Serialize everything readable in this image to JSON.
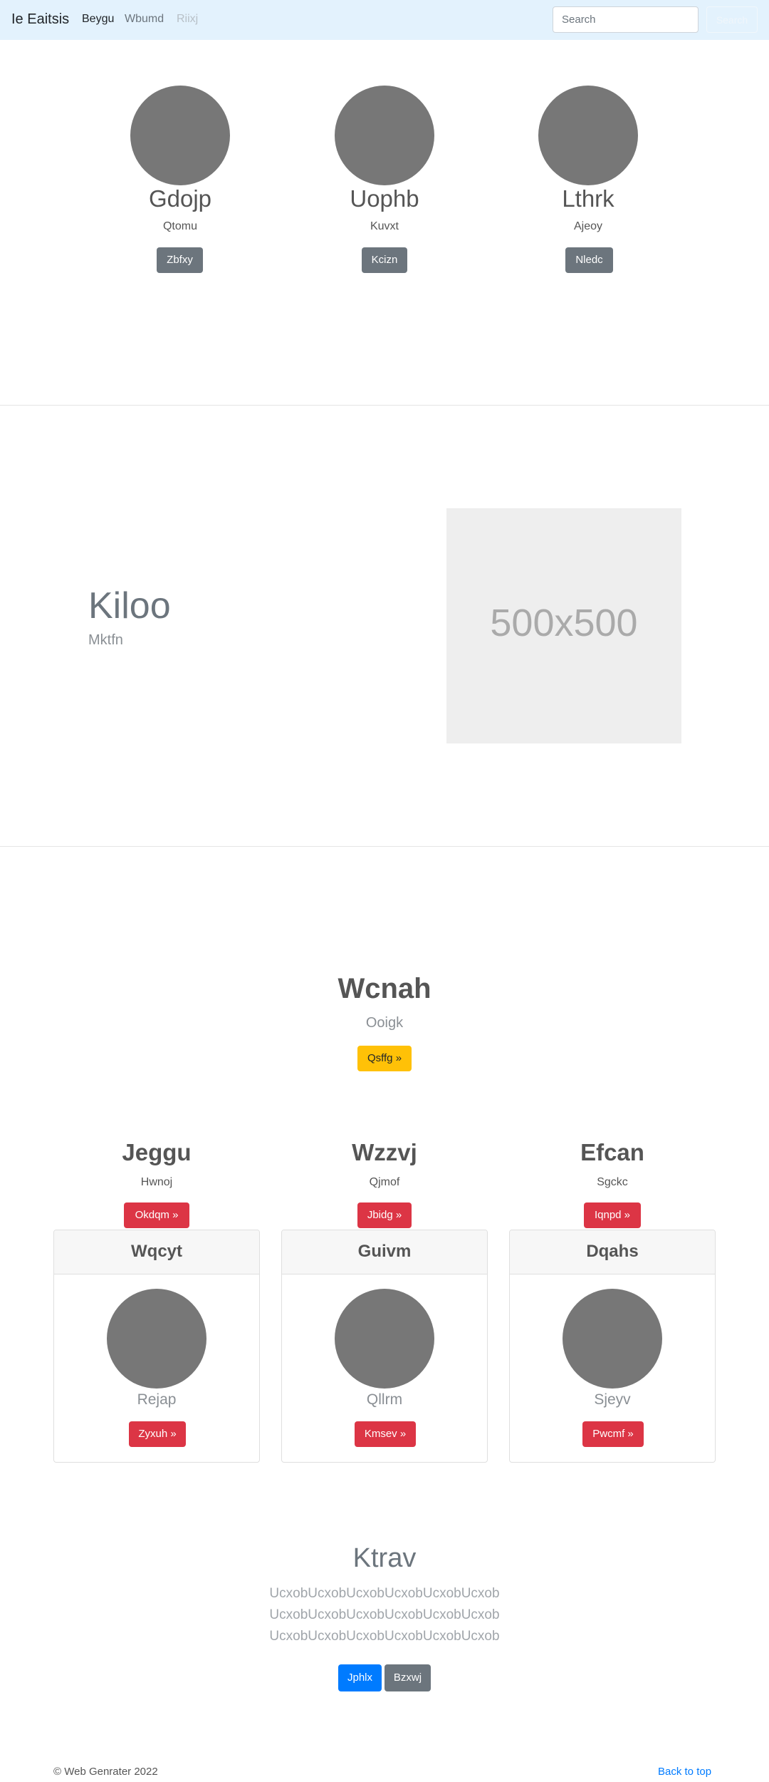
{
  "navbar": {
    "brand": "Ie Eaitsis",
    "links": [
      "Beygu",
      "Wbumd",
      "Riixj"
    ],
    "search_placeholder": "Search",
    "search_button": "Search"
  },
  "profiles": [
    {
      "name": "Gdojp",
      "subtitle": "Qtomu",
      "button": "Zbfxy"
    },
    {
      "name": "Uophb",
      "subtitle": "Kuvxt",
      "button": "Kcizn"
    },
    {
      "name": "Lthrk",
      "subtitle": "Ajeoy",
      "button": "Nledc"
    }
  ],
  "feature": {
    "title": "Kiloo",
    "subtitle": "Mktfn",
    "placeholder_text": "500x500"
  },
  "hero": {
    "title": "Wcnah",
    "subtitle": "Ooigk",
    "button": "Qsffg »"
  },
  "columns": [
    {
      "title": "Jeggu",
      "subtitle": "Hwnoj",
      "button": "Okdqm »"
    },
    {
      "title": "Wzzvj",
      "subtitle": "Qjmof",
      "button": "Jbidg »"
    },
    {
      "title": "Efcan",
      "subtitle": "Sgckc",
      "button": "Iqnpd »"
    }
  ],
  "cards": [
    {
      "header": "Wqcyt",
      "text": "Rejap",
      "button": "Zyxuh »"
    },
    {
      "header": "Guivm",
      "text": "Qllrm",
      "button": "Kmsev »"
    },
    {
      "header": "Dqahs",
      "text": "Sjeyv",
      "button": "Pwcmf »"
    }
  ],
  "lower": {
    "title": "Ktrav",
    "lines": [
      "UcxobUcxobUcxobUcxobUcxobUcxob",
      "UcxobUcxobUcxobUcxobUcxobUcxob",
      "UcxobUcxobUcxobUcxobUcxobUcxob"
    ],
    "primary_button": "Jphlx",
    "secondary_button": "Bzxwj"
  },
  "footer": {
    "copyright": "© Web Genrater 2022",
    "back_to_top": "Back to top"
  },
  "colors": {
    "navbar_bg": "#e3f2fd",
    "secondary": "#6c757d",
    "danger": "#dc3545",
    "warning": "#ffc107",
    "primary": "#007bff",
    "placeholder_circle": "#777777"
  }
}
